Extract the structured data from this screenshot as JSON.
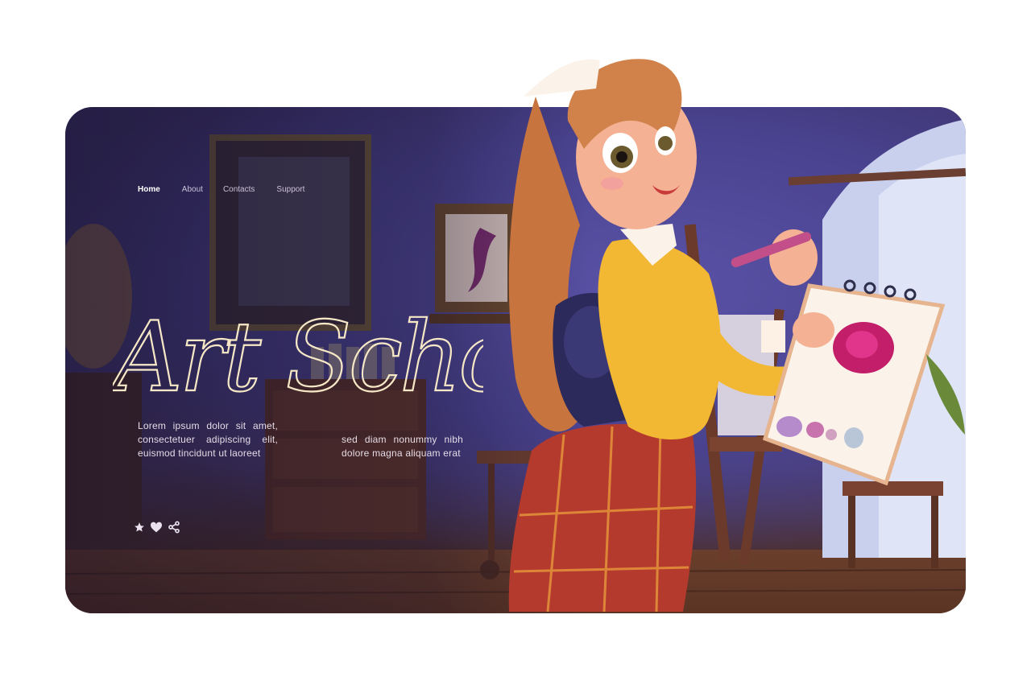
{
  "nav": {
    "home": "Home",
    "about": "About",
    "contacts": "Contacts",
    "support": "Support"
  },
  "hero": {
    "title": "Art School",
    "text_left": "Lorem ipsum dolor sit amet, consectetuer adipiscing elit, euismod tincidunt ut laoreet",
    "text_right": "sed diam nonummy nibh dolore magna aliquam erat"
  },
  "social_icons": [
    "star-icon",
    "heart-icon",
    "share-icon"
  ],
  "colors": {
    "card_bg": "#3e3672",
    "title": "#f5e8c8",
    "text": "#e4dbe6",
    "nav_active": "#ffffff"
  }
}
